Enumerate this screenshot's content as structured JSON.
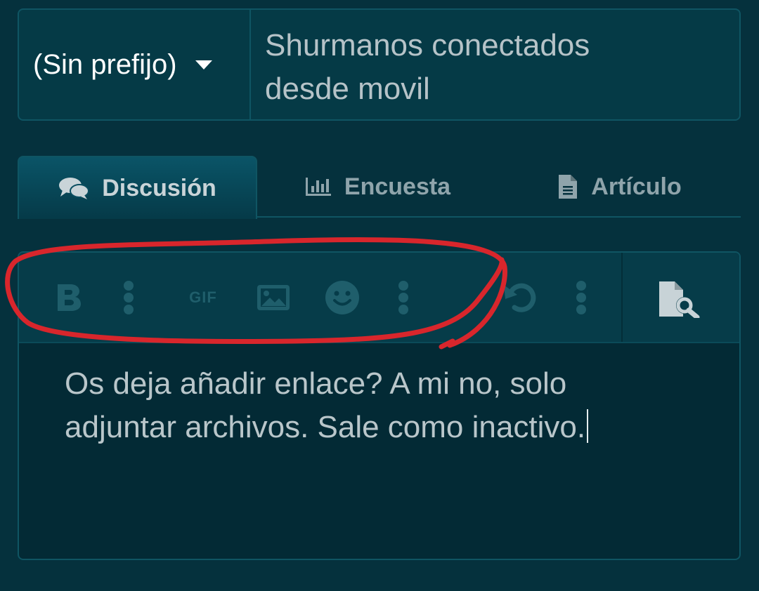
{
  "thread": {
    "prefix_label": "(Sin prefijo)",
    "title_line1": "Shurmanos conectados",
    "title_line2": "desde movil"
  },
  "tabs": [
    {
      "label": "Discusión",
      "icon": "chat-bubbles-icon",
      "active": true
    },
    {
      "label": "Encuesta",
      "icon": "poll-chart-icon",
      "active": false
    },
    {
      "label": "Artículo",
      "icon": "document-icon",
      "active": false
    }
  ],
  "toolbar": {
    "buttons": [
      "bold-icon",
      "more-vertical-icon",
      "gif-icon",
      "image-icon",
      "smiley-icon",
      "more-vertical-icon",
      "undo-icon",
      "more-vertical-icon",
      "preview-icon"
    ],
    "gif_label": "GIF"
  },
  "editor": {
    "text_line1": "Os deja añadir enlace? A mi no, solo",
    "text_line2": "adjuntar archivos. Sale como inactivo."
  },
  "colors": {
    "background": "#05313d",
    "border": "#0f5563",
    "disabled_icon": "#1f5e6b",
    "enabled_icon": "#c8d3d7",
    "annotation": "#d8262c"
  }
}
